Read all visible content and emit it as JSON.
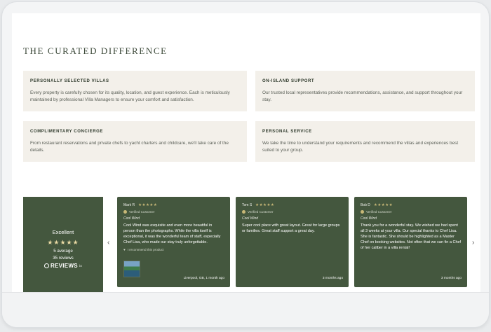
{
  "section_title": "THE CURATED DIFFERENCE",
  "features": [
    {
      "title": "PERSONALLY SELECTED VILLAS",
      "desc": "Every property is carefully chosen for its quality, location, and guest experience. Each is meticulously maintained by professional Villa Managers to ensure your comfort and satisfaction."
    },
    {
      "title": "ON-ISLAND SUPPORT",
      "desc": "Our trusted local representatives provide recommendations, assistance, and support throughout your stay."
    },
    {
      "title": "COMPLIMENTARY CONCIERGE",
      "desc": "From restaurant reservations and private chefs to yacht charters and childcare, we'll take care of the details."
    },
    {
      "title": "PERSONAL SERVICE",
      "desc": "We take the time to understand your requirements and recommend the villas and experiences best suited to your group."
    }
  ],
  "summary": {
    "rating_word": "Excellent",
    "stars": "★★★★★",
    "average": "5 average",
    "count": "35 reviews",
    "brand": "REVIEWS",
    "brand_suffix": "io"
  },
  "nav": {
    "prev": "‹",
    "next": "›"
  },
  "reviews": [
    {
      "author": "Mark R",
      "stars": "★★★★★",
      "verified": "Verified Customer",
      "product": "Cool Wind",
      "text": "Cool Wind was exquisite and even more beautiful in person than the photographs. While the villa itself is exceptional, it was the wonderful team of staff, especially Chef Lisa, who made our stay truly unforgettable.",
      "recommend": "I recommend this product",
      "meta": "Liverpool, GB, 1 month ago"
    },
    {
      "author": "Tom S",
      "stars": "★★★★★",
      "verified": "Verified Customer",
      "product": "Cool Wind",
      "text": "Super cool place with great layout. Great for large groups or families. Great staff support a great day.",
      "meta": "3 months ago"
    },
    {
      "author": "Bob D",
      "stars": "★★★★★",
      "verified": "Verified Customer",
      "product": "Cool Wind",
      "text": "Thank you for a wonderful stay. We wished we had spent all 3 weeks at your villa. Our special thanks to Chef Lisa. She is fantastic. She should be highlighted as a Master Chef on booking websites. Not often that we can fin a Chef of her caliber in a villa rental!",
      "meta": "3 months ago"
    }
  ],
  "colors": {
    "card_green": "#44573e",
    "feature_bg": "#f3f0ea",
    "star_gold": "#c8b877"
  }
}
